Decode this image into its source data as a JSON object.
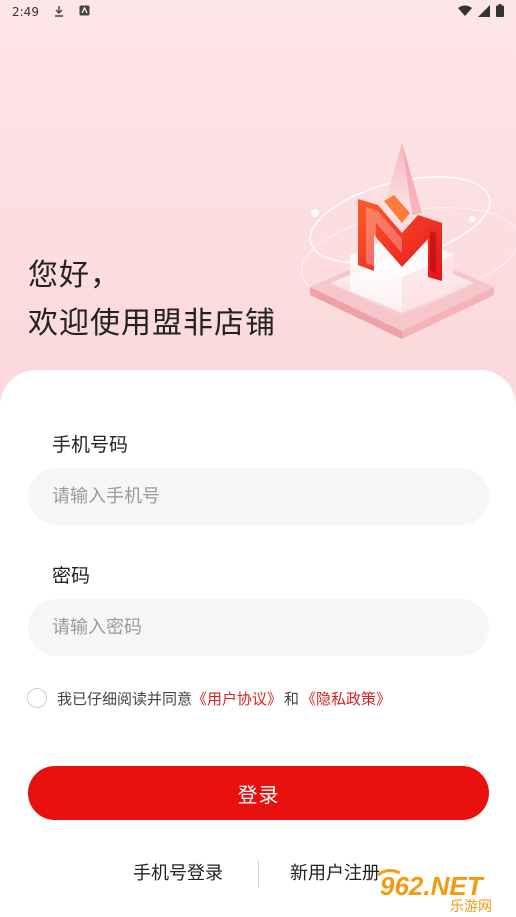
{
  "status_bar": {
    "time": "2:49"
  },
  "greeting": {
    "line1": "您好，",
    "line2": "欢迎使用盟非店铺"
  },
  "form": {
    "phone_label": "手机号码",
    "phone_placeholder": "请输入手机号",
    "phone_value": "",
    "password_label": "密码",
    "password_placeholder": "请输入密码",
    "password_value": ""
  },
  "agreement": {
    "prefix": "我已仔细阅读并同意",
    "user_agreement": "《用户协议》",
    "and": "和",
    "privacy_policy": "《隐私政策》",
    "checked": false
  },
  "login_button": "登录",
  "bottom": {
    "phone_login": "手机号登录",
    "register": "新用户注册"
  },
  "watermark": {
    "text": "962.NET",
    "subtext": "乐游网"
  },
  "colors": {
    "brand_red": "#e8100f",
    "link_red": "#d9211f",
    "bg_pink": "#fde6e8"
  }
}
